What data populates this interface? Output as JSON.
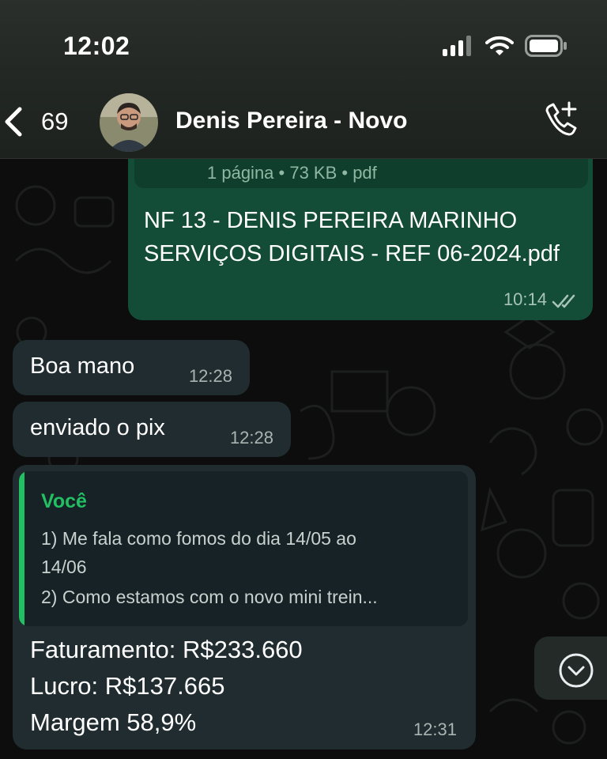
{
  "status_bar": {
    "time": "12:02",
    "icons": [
      "signal-icon",
      "wifi-icon",
      "battery-icon"
    ]
  },
  "header": {
    "back_count": "69",
    "contact_name": "Denis Pereira - Novo",
    "back_icon": "chevron-left-icon",
    "call_icon": "add-call-icon"
  },
  "messages": [
    {
      "direction": "outgoing",
      "type": "document",
      "doc_meta": "1 página • 73 KB • pdf",
      "doc_title": "NF 13 - DENIS PEREIRA MARINHO SERVIÇOS DIGITAIS - REF 06-2024.pdf",
      "time": "10:14",
      "status_icon": "double-check-icon"
    },
    {
      "direction": "incoming",
      "text": "Boa mano",
      "time": "12:28"
    },
    {
      "direction": "incoming",
      "text": "enviado o pix",
      "time": "12:28"
    },
    {
      "direction": "incoming",
      "quote": {
        "author": "Você",
        "lines": [
          "1) Me fala como fomos do dia 14/05 ao",
          "14/06",
          "2) Como estamos com o novo mini trein..."
        ]
      },
      "lines": [
        "Faturamento: R$233.660",
        "Lucro: R$137.665",
        "Margem 58,9%"
      ],
      "time": "12:31"
    }
  ],
  "scroll_button": {
    "icon": "chevron-down-circle-icon"
  },
  "colors": {
    "outgoing_bubble": "#144d37",
    "incoming_bubble": "#202c2f",
    "quote_accent": "#21c063",
    "header_bg": "#232824"
  }
}
